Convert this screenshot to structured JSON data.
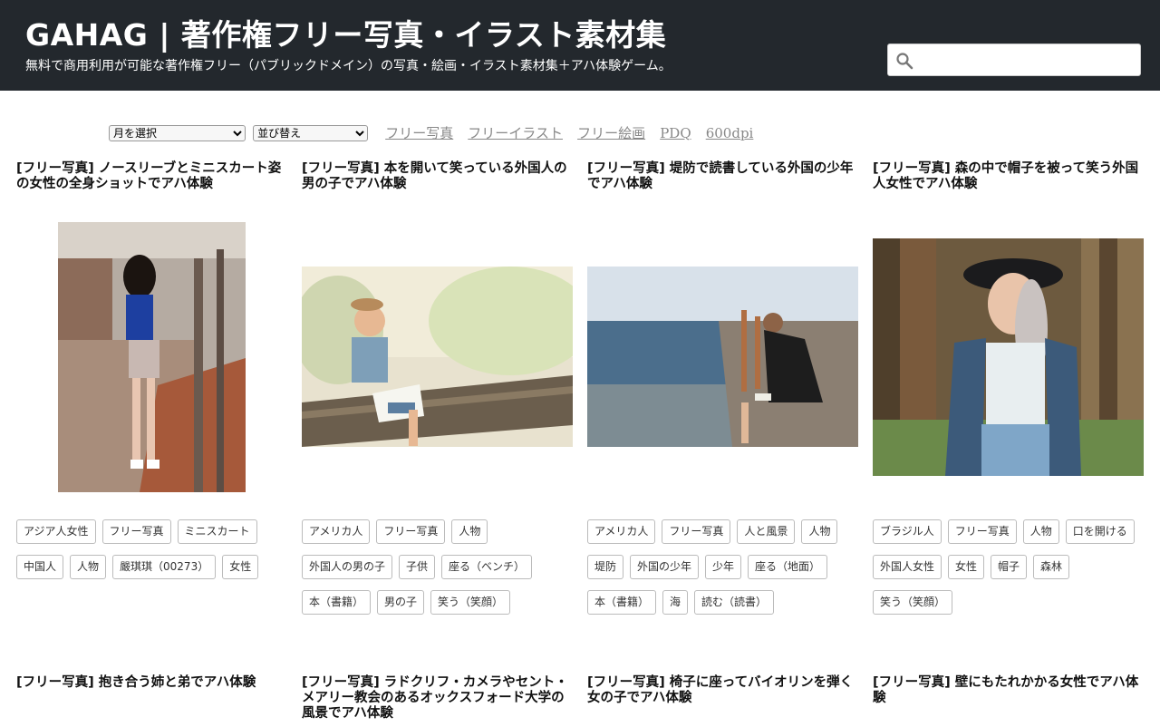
{
  "header": {
    "title": "GAHAG | 著作権フリー写真・イラスト素材集",
    "description": "無料で商用利用が可能な著作権フリー（パブリックドメイン）の写真・絵画・イラスト素材集＋アハ体験ゲーム。",
    "search_placeholder": ""
  },
  "filters": {
    "month_select": "月を選択",
    "sort_select": "並び替え",
    "links": [
      "フリー写真",
      "フリーイラスト",
      "フリー絵画",
      "PDQ",
      "600dpi"
    ]
  },
  "cards": [
    {
      "title": "[フリー写真] ノースリーブとミニスカート姿の女性の全身ショットでアハ体験",
      "tags": [
        "アジア人女性",
        "フリー写真",
        "ミニスカート",
        "中国人",
        "人物",
        "嚴琪琪（00273）",
        "女性"
      ]
    },
    {
      "title": "[フリー写真] 本を開いて笑っている外国人の男の子でアハ体験",
      "tags": [
        "アメリカ人",
        "フリー写真",
        "人物",
        "外国人の男の子",
        "子供",
        "座る（ベンチ）",
        "本（書籍）",
        "男の子",
        "笑う（笑顔）"
      ]
    },
    {
      "title": "[フリー写真] 堤防で読書している外国の少年でアハ体験",
      "tags": [
        "アメリカ人",
        "フリー写真",
        "人と風景",
        "人物",
        "堤防",
        "外国の少年",
        "少年",
        "座る（地面）",
        "本（書籍）",
        "海",
        "読む（読書）"
      ]
    },
    {
      "title": "[フリー写真] 森の中で帽子を被って笑う外国人女性でアハ体験",
      "tags": [
        "ブラジル人",
        "フリー写真",
        "人物",
        "口を開ける",
        "外国人女性",
        "女性",
        "帽子",
        "森林",
        "笑う（笑顔）"
      ]
    }
  ],
  "next_cards": [
    {
      "title": "[フリー写真] 抱き合う姉と弟でアハ体験"
    },
    {
      "title": "[フリー写真] ラドクリフ・カメラやセント・メアリー教会のあるオックスフォード大学の風景でアハ体験"
    },
    {
      "title": "[フリー写真] 椅子に座ってバイオリンを弾く女の子でアハ体験"
    },
    {
      "title": "[フリー写真] 壁にもたれかかる女性でアハ体験"
    }
  ]
}
